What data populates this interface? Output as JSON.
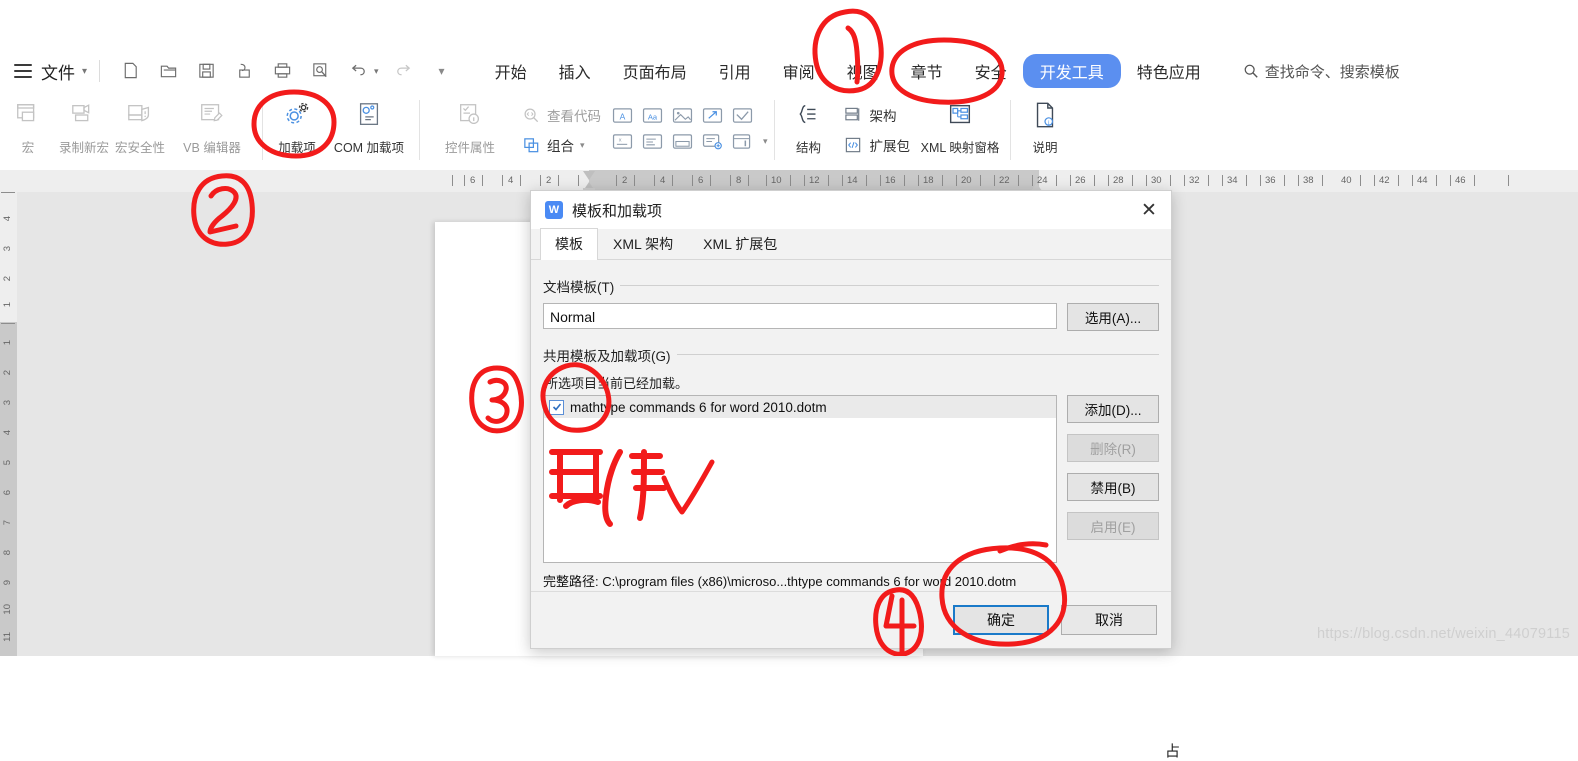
{
  "menubar": {
    "file_label": "文件",
    "quick_icons": [
      "new-document-icon",
      "open-folder-icon",
      "save-icon",
      "save-as-icon",
      "print-icon",
      "print-preview-icon",
      "undo-icon",
      "redo-icon",
      "customize-quick-access-icon"
    ],
    "tabs": [
      {
        "label": "开始",
        "active": false
      },
      {
        "label": "插入",
        "active": false
      },
      {
        "label": "页面布局",
        "active": false
      },
      {
        "label": "引用",
        "active": false
      },
      {
        "label": "审阅",
        "active": false
      },
      {
        "label": "视图",
        "active": false
      },
      {
        "label": "章节",
        "active": false
      },
      {
        "label": "安全",
        "active": false
      },
      {
        "label": "开发工具",
        "active": true
      },
      {
        "label": "特色应用",
        "active": false
      }
    ],
    "search_placeholder": "查找命令、搜索模板"
  },
  "ribbon": {
    "group_macro": [
      {
        "label": "宏",
        "icon": "macro-icon",
        "enabled": false
      },
      {
        "label": "录制新宏",
        "icon": "record-macro-icon",
        "enabled": false
      },
      {
        "label": "宏安全性",
        "icon": "macro-security-icon",
        "enabled": false
      },
      {
        "label": "VB 编辑器",
        "icon": "vb-editor-icon",
        "enabled": false
      }
    ],
    "group_addins": [
      {
        "label": "加载项",
        "icon": "addins-gear-icon",
        "enabled": true
      },
      {
        "label": "COM 加载项",
        "icon": "com-addins-icon",
        "enabled": true
      }
    ],
    "group_controls": [
      {
        "label": "控件属性",
        "icon": "control-properties-icon",
        "enabled": false
      },
      {
        "label": "查看代码",
        "icon": "view-code-icon",
        "enabled": false
      },
      {
        "label": "组合",
        "icon": "group-icon",
        "enabled": true
      }
    ],
    "control_grid_row1": [
      "text-field-icon",
      "rich-text-icon",
      "picture-control-icon",
      "legacy-control-icon",
      "checkbox-control-icon"
    ],
    "control_grid_row2": [
      "combo-box-icon",
      "dropdown-list-icon",
      "date-picker-icon",
      "building-block-icon",
      "legacy-tools-icon"
    ],
    "group_xml": [
      {
        "label": "结构",
        "icon": "xml-structure-icon",
        "enabled": true
      },
      {
        "label": "架构",
        "icon": "xml-schema-icon",
        "enabled": true
      },
      {
        "label": "扩展包",
        "icon": "xml-expansion-pack-icon",
        "enabled": true
      }
    ],
    "group_xml_pane": [
      {
        "label": "XML 映射窗格",
        "icon": "xml-mapping-pane-icon",
        "enabled": true
      },
      {
        "label": "说明",
        "icon": "help-doc-icon",
        "enabled": true
      }
    ]
  },
  "ruler": {
    "h_left_ticks": [
      "6",
      "4",
      "2"
    ],
    "h_main_ticks": [
      "2",
      "4",
      "6",
      "8",
      "10",
      "12",
      "14",
      "16",
      "18",
      "20",
      "22",
      "24",
      "26",
      "28",
      "30",
      "32",
      "34",
      "36",
      "38"
    ],
    "h_right_ticks": [
      "40",
      "42",
      "44",
      "46"
    ],
    "v_top_ticks": [
      "4",
      "3",
      "2",
      "1"
    ],
    "v_main_ticks": [
      "1",
      "2",
      "3",
      "4",
      "5",
      "6",
      "7",
      "8",
      "9",
      "10",
      "11"
    ]
  },
  "document": {
    "stray_char": "占"
  },
  "dialog": {
    "title": "模板和加载项",
    "logo_letter": "W",
    "close_icon": "close-icon",
    "tabs": [
      {
        "label": "模板",
        "active": true
      },
      {
        "label": "XML 架构",
        "active": false
      },
      {
        "label": "XML 扩展包",
        "active": false
      }
    ],
    "doc_template": {
      "legend": "文档模板(T)",
      "value": "Normal",
      "button": "选用(A)..."
    },
    "shared_templates": {
      "legend": "共用模板及加载项(G)",
      "hint": "所选项目当前已经加载。",
      "items": [
        {
          "name": "mathtype commands 6 for word 2010.dotm",
          "checked": true,
          "selected": true
        }
      ],
      "buttons": [
        {
          "label": "添加(D)...",
          "enabled": true
        },
        {
          "label": "删除(R)",
          "enabled": false
        },
        {
          "label": "禁用(B)",
          "enabled": true
        },
        {
          "label": "启用(E)",
          "enabled": false
        }
      ]
    },
    "full_path_label": "完整路径:",
    "full_path_value": "C:\\program files (x86)\\microso...thtype commands 6 for word 2010.dotm",
    "footer": {
      "ok": "确定",
      "cancel": "取消"
    }
  },
  "annotations": {
    "color": "#f21b1b",
    "marks": [
      {
        "id": "annot-1",
        "text": "1",
        "kind": "numbered-circle"
      },
      {
        "id": "annot-2",
        "text": "2",
        "kind": "numbered-circle"
      },
      {
        "id": "annot-3",
        "text": "3",
        "kind": "numbered-circle"
      },
      {
        "id": "annot-4",
        "text": "4",
        "kind": "numbered-circle"
      },
      {
        "id": "annot-dev-tools",
        "text": "",
        "kind": "circle-highlight"
      },
      {
        "id": "annot-addins",
        "text": "",
        "kind": "circle-highlight"
      },
      {
        "id": "annot-checkbox",
        "text": "",
        "kind": "circle-highlight"
      },
      {
        "id": "annot-ok",
        "text": "",
        "kind": "circle-highlight"
      },
      {
        "id": "annot-cancel-word",
        "text": "取消",
        "kind": "handwritten-text"
      },
      {
        "id": "annot-checkmark",
        "text": "",
        "kind": "checkmark"
      }
    ],
    "handwritten_cancel": "取消"
  },
  "watermark": {
    "text": "https://blog.csdn.net/weixin_44079115"
  }
}
